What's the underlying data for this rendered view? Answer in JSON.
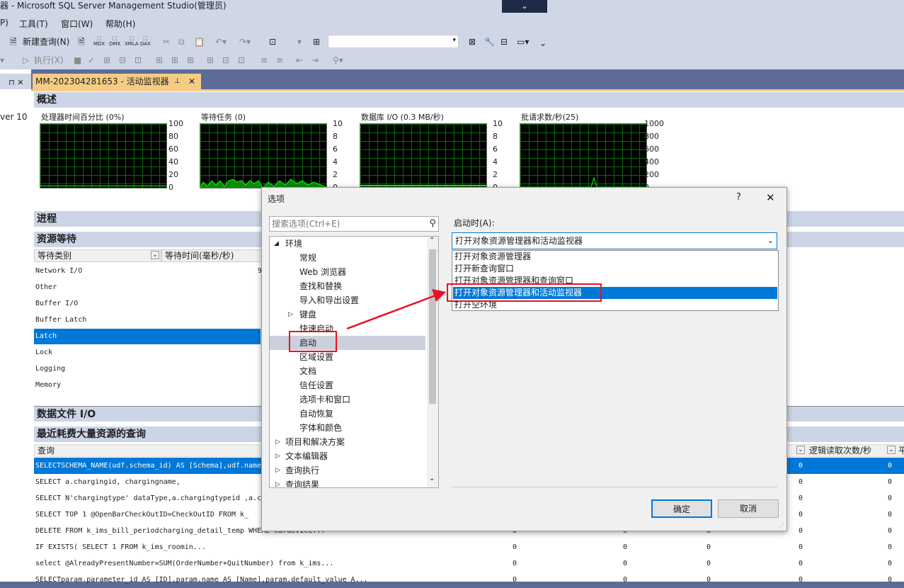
{
  "window": {
    "title": "器 - Microsoft SQL Server Management Studio(管理员)",
    "title_dropdown_icon": "chevron-down-icon"
  },
  "menu": {
    "partial": "P)",
    "tools": "工具(T)",
    "window": "窗口(W)",
    "help": "帮助(H)"
  },
  "toolbar": {
    "new_query": "新建查询(N)",
    "mdx": "MDX",
    "dmx": "DMX",
    "xmla": "XMLA",
    "dax": "DAX",
    "execute": "执行(X)",
    "combo_value": ""
  },
  "left_pane": {
    "header_icons": "ᅟ⊓ ✕",
    "server_text": "ver 10"
  },
  "tab": {
    "label": "MM-202304281653 - 活动监视器",
    "pin": "ᅟ⊥",
    "close": "✕"
  },
  "overview": {
    "title": "概述",
    "graphs": [
      {
        "label": "处理器时间百分比 (0%)",
        "ticks": [
          "100",
          "80",
          "60",
          "40",
          "20",
          "0"
        ]
      },
      {
        "label": "等待任务 (0)",
        "ticks": [
          "10",
          "8",
          "6",
          "4",
          "2",
          "0"
        ]
      },
      {
        "label": "数据库 I/O (0.3 MB/秒)",
        "ticks": [
          "10",
          "8",
          "6",
          "4",
          "2",
          "0"
        ]
      },
      {
        "label": "批请求数/秒(25)",
        "ticks": [
          "1000",
          "800",
          "600",
          "400",
          "200",
          "0"
        ]
      }
    ]
  },
  "sections": {
    "processes": "进程",
    "resource_waits": "资源等待",
    "data_file_io": "数据文件 I/O",
    "recent_queries": "最近耗费大量资源的查询"
  },
  "resource_waits": {
    "col_type": "等待类别",
    "col_time": "等待时间(毫秒/秒)",
    "rows": [
      "Network I/O",
      "Other",
      "Buffer I/O",
      "Buffer Latch",
      "Latch",
      "Lock",
      "Logging",
      "Memory"
    ],
    "selected": "Latch",
    "partial_value": "9"
  },
  "queries": {
    "col_query": "查询",
    "col_logical_reads": "逻辑读取次数/秒",
    "col_partial": "平",
    "rows": [
      {
        "text": "SELECTSCHEMA_NAME(udf.schema_id) AS [Schema],udf.name",
        "v1": "",
        "v2": "",
        "v3": "",
        "v4": "0",
        "v5": "0"
      },
      {
        "text": "SELECT a.chargingid,                chargingname,",
        "v1": "",
        "v2": "",
        "v3": "",
        "v4": "0",
        "v5": "0"
      },
      {
        "text": "SELECT N'chargingtype' dataType,a.chargingtypeid ,a.c",
        "v1": "",
        "v2": "",
        "v3": "",
        "v4": "0",
        "v5": "0"
      },
      {
        "text": "SELECT  TOP 1 @OpenBarCheckOutID=CheckOutID   FROM k_",
        "v1": "",
        "v2": "",
        "v3": "",
        "v4": "0",
        "v5": "0"
      },
      {
        "text": "DELETE FROM k_ims_bill_periodcharging_detail_temp           WHERE  cardevice...",
        "v1": "0",
        "v2": "0",
        "v3": "0",
        "v4": "0",
        "v5": "0"
      },
      {
        "text": "IF EXISTS(                  SELECT 1                FROM   k_ims_roomin...",
        "v1": "0",
        "v2": "0",
        "v3": "0",
        "v4": "0",
        "v5": "0"
      },
      {
        "text": "select @AlreadyPresentNumber=SUM(OrderNumber+QuitNumber)          from k_ims...",
        "v1": "0",
        "v2": "0",
        "v3": "0",
        "v4": "0",
        "v5": "0"
      },
      {
        "text": "SELECTparam.parameter_id AS [ID],param.name AS [Name],param.default_value A...",
        "v1": "0",
        "v2": "0",
        "v3": "0",
        "v4": "0",
        "v5": "0"
      }
    ]
  },
  "dialog": {
    "title": "选项",
    "help": "?",
    "close": "✕",
    "search_placeholder": "搜索选项(Ctrl+E)",
    "tree": [
      {
        "label": "环境",
        "level": 0,
        "expander": "◢"
      },
      {
        "label": "常规",
        "level": 1
      },
      {
        "label": "Web 浏览器",
        "level": 1
      },
      {
        "label": "查找和替换",
        "level": 1
      },
      {
        "label": "导入和导出设置",
        "level": 1
      },
      {
        "label": "键盘",
        "level": 1,
        "expander": "▷"
      },
      {
        "label": "快速启动",
        "level": 1
      },
      {
        "label": "启动",
        "level": 1,
        "selected": true
      },
      {
        "label": "区域设置",
        "level": 1
      },
      {
        "label": "文档",
        "level": 1
      },
      {
        "label": "信任设置",
        "level": 1
      },
      {
        "label": "选项卡和窗口",
        "level": 1
      },
      {
        "label": "自动恢复",
        "level": 1
      },
      {
        "label": "字体和颜色",
        "level": 1
      },
      {
        "label": "项目和解决方案",
        "level": 0,
        "expander": "▷"
      },
      {
        "label": "文本编辑器",
        "level": 0,
        "expander": "▷"
      },
      {
        "label": "查询执行",
        "level": 0,
        "expander": "▷"
      },
      {
        "label": "查询结果",
        "level": 0,
        "expander": "▷"
      }
    ],
    "startup_label": "启动时(A):",
    "startup_value": "打开对象资源管理器和活动监视器",
    "options": [
      "打开对象资源管理器",
      "打开新查询窗口",
      "打开对象资源管理器和查询窗口",
      "打开对象资源管理器和活动监视器",
      "打开空环境"
    ],
    "selected_option": "打开对象资源管理器和活动监视器",
    "ok": "确定",
    "cancel": "取消"
  },
  "colors": {
    "accent": "#0078d7",
    "tab": "#f5cc84",
    "header": "#ccd5e6",
    "annotation": "#e81123"
  }
}
